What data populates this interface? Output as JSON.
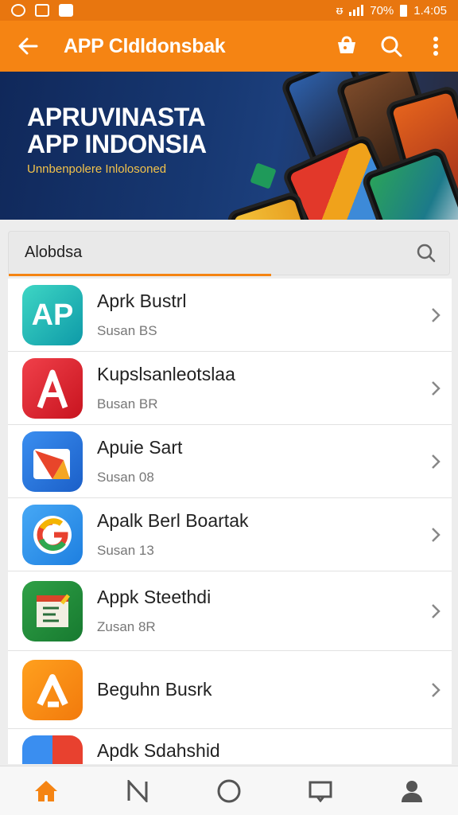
{
  "status_bar": {
    "battery": "70%",
    "time": "1.4:05"
  },
  "appbar": {
    "title": "APP Cldldonsbak",
    "back_icon": "arrow-left-icon",
    "actions": [
      "store-bag-icon",
      "search-icon",
      "more-vert-icon"
    ]
  },
  "banner": {
    "headline_line1": "APRUVINASTA",
    "headline_line2": "APP INDONSIA",
    "subline": "Unnbenpolere Inlolosoned"
  },
  "search": {
    "value": "Alobdsa",
    "placeholder": "Alobdsa"
  },
  "apps": [
    {
      "name": "Aprk Bustrl",
      "meta": "Susan BS"
    },
    {
      "name": "Kupslsanleotslaa",
      "meta": "Busan BR"
    },
    {
      "name": "Apuie Sart",
      "meta": "Susan 08"
    },
    {
      "name": "Apalk Berl Boartak",
      "meta": "Susan 13"
    },
    {
      "name": "Appk Steethdi",
      "meta": "Zusan 8R"
    },
    {
      "name": "Beguhn Busrk",
      "meta": ""
    },
    {
      "name": "Apdk Sdahshid",
      "meta": ""
    }
  ],
  "bottom_nav": [
    "home-icon",
    "n-letter-icon",
    "circle-icon",
    "message-icon",
    "profile-icon"
  ],
  "colors": {
    "accent": "#f58413",
    "status_bar": "#e8760f",
    "banner_bg": "#173872",
    "subline": "#f2c24a"
  }
}
